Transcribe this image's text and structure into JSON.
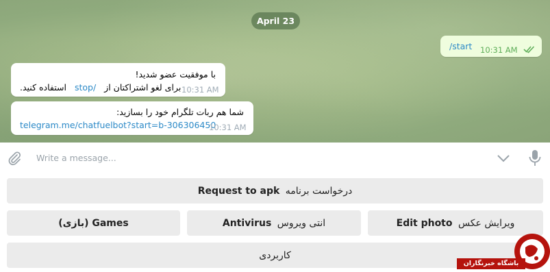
{
  "chat": {
    "date": "April 23",
    "messages": {
      "outgoing_1": {
        "text": "/start",
        "time": "10:31 AM"
      },
      "incoming_1": {
        "line1": "با موفقیت عضو شدید!",
        "line2_text": "برای لغو اشتراکتان از",
        "line2_link": "stop/",
        "line2_suffix": "استفاده کنید.",
        "time": "10:31 AM"
      },
      "incoming_2": {
        "line1": "شما هم ربات تلگرام خود را بسازید:",
        "link": "telegram.me/chatfuelbot?start=b-306306450",
        "time": "10:31 AM"
      }
    }
  },
  "input": {
    "placeholder": "Write a message..."
  },
  "keyboard": {
    "row1": [
      {
        "label_fa": "درخواست برنامه",
        "label_en": "Request to apk"
      }
    ],
    "row2": [
      {
        "label": "(بازی) Games"
      },
      {
        "label_fa": "انتی ویروس",
        "label_en": "Antivirus"
      },
      {
        "label_fa": "ویرایش عکس",
        "label_en": "Edit photo"
      }
    ],
    "row3": [
      {
        "label": "کاربردی"
      }
    ]
  },
  "watermark": {
    "text": "باشگاه خبرنگاران"
  },
  "colors": {
    "accent_link": "#2b89c7",
    "check_green": "#5dad58",
    "button_bg": "#ebebeb",
    "watermark_red": "#b5130d"
  },
  "icons": {
    "attach": "paperclip-icon",
    "bot_keyboard": "chevron-down-icon",
    "mic": "microphone-icon",
    "read": "double-check-icon"
  }
}
